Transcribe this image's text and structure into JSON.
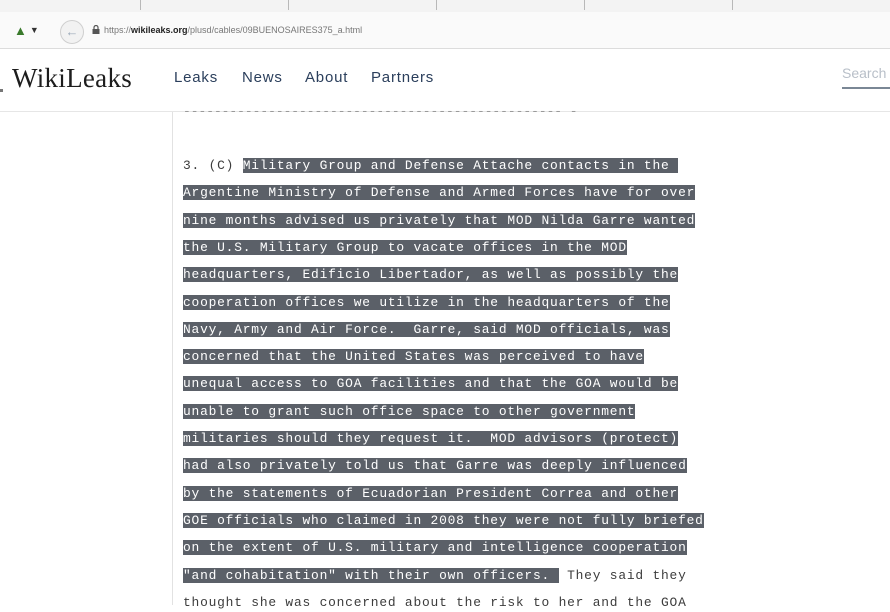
{
  "browser": {
    "url_prefix": "https://",
    "url_domain": "wikileaks.org",
    "url_path": "/plusd/cables/09BUENOSAIRES375_a.html"
  },
  "site": {
    "logo": "WikiLeaks",
    "nav": [
      {
        "label": "Leaks"
      },
      {
        "label": "News"
      },
      {
        "label": "About"
      },
      {
        "label": "Partners"
      }
    ],
    "search_placeholder": "Search"
  },
  "cable": {
    "divider": "------------------------------------------------- -",
    "lines": [
      {
        "plain": "3. (C) ",
        "highlight": "Military Group and Defense Attache contacts in the ",
        "tail": ""
      },
      {
        "plain": "",
        "highlight": "Argentine Ministry of Defense and Armed Forces have for over",
        "tail": ""
      },
      {
        "plain": "",
        "highlight": "nine months advised us privately that MOD Nilda Garre wanted",
        "tail": ""
      },
      {
        "plain": "",
        "highlight": "the U.S. Military Group to vacate offices in the MOD",
        "tail": ""
      },
      {
        "plain": "",
        "highlight": "headquarters, Edificio Libertador, as well as possibly the",
        "tail": ""
      },
      {
        "plain": "",
        "highlight": "cooperation offices we utilize in the headquarters of the",
        "tail": ""
      },
      {
        "plain": "",
        "highlight": "Navy, Army and Air Force.  Garre, said MOD officials, was",
        "tail": ""
      },
      {
        "plain": "",
        "highlight": "concerned that the United States was perceived to have",
        "tail": ""
      },
      {
        "plain": "",
        "highlight": "unequal access to GOA facilities and that the GOA would be",
        "tail": ""
      },
      {
        "plain": "",
        "highlight": "unable to grant such office space to other government",
        "tail": ""
      },
      {
        "plain": "",
        "highlight": "militaries should they request it.  MOD advisors (protect)",
        "tail": ""
      },
      {
        "plain": "",
        "highlight": "had also privately told us that Garre was deeply influenced",
        "tail": ""
      },
      {
        "plain": "",
        "highlight": "by the statements of Ecuadorian President Correa and other",
        "tail": ""
      },
      {
        "plain": "",
        "highlight": "GOE officials who claimed in 2008 they were not fully briefed",
        "tail": ""
      },
      {
        "plain": "",
        "highlight": "on the extent of U.S. military and intelligence cooperation",
        "tail": ""
      },
      {
        "plain": "",
        "highlight": "\"and cohabitation\" with their own officers. ",
        "tail": " They said they"
      },
      {
        "plain": "",
        "highlight": "",
        "tail": "thought she was concerned about the risk to her and the GOA"
      }
    ]
  }
}
